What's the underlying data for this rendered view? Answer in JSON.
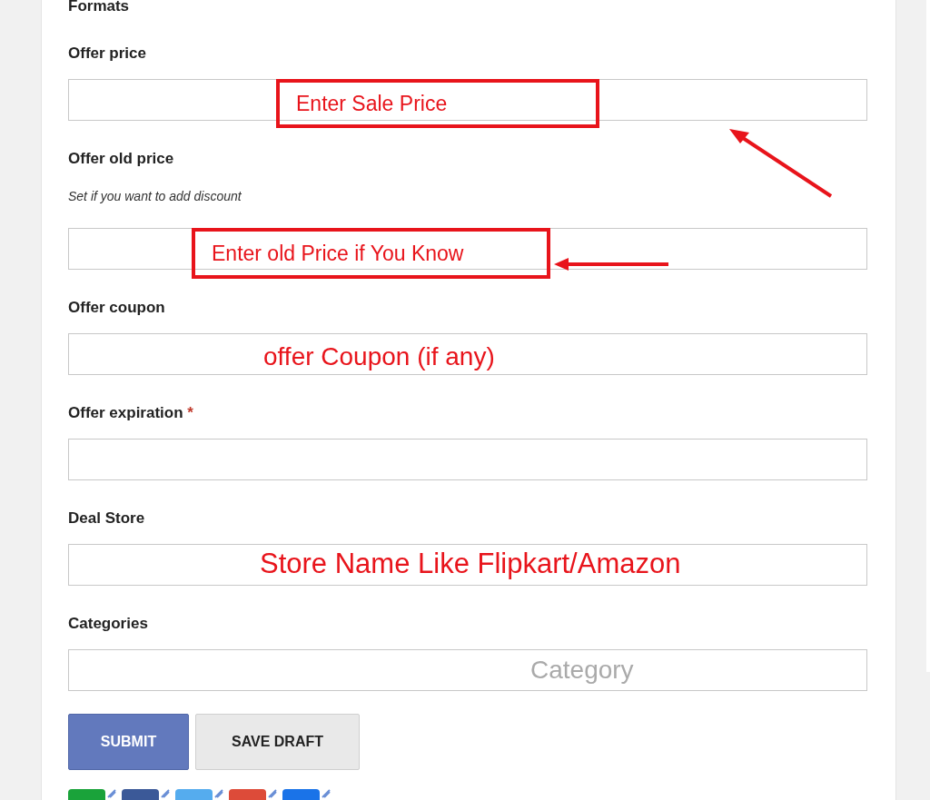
{
  "section_title": "Formats",
  "fields": [
    {
      "label": "Offer price",
      "required": false,
      "annotation": {
        "kind": "boxed",
        "text": "Enter Sale Price",
        "arrow": true
      }
    },
    {
      "label": "Offer old price",
      "hint": "Set if you want to add discount",
      "required": false,
      "annotation": {
        "kind": "boxed",
        "text": "Enter old Price if You Know",
        "arrow": true
      }
    },
    {
      "label": "Offer coupon",
      "required": false,
      "annotation": {
        "kind": "plain",
        "text": "offer Coupon (if any)"
      }
    },
    {
      "label": "Offer expiration",
      "required": true,
      "required_mark": "*"
    },
    {
      "label": "Deal Store",
      "required": false,
      "annotation": {
        "kind": "plain",
        "text": "Store Name Like Flipkart/Amazon"
      }
    },
    {
      "label": "Categories",
      "required": false,
      "placeholder": "Category"
    }
  ],
  "buttons": [
    {
      "label": "SUBMIT",
      "kind": "primary"
    },
    {
      "label": "SAVE DRAFT",
      "kind": "secondary"
    }
  ],
  "share_buttons": [
    {
      "color": "#1aa33a"
    },
    {
      "color": "#3b5998"
    },
    {
      "color": "#55acee"
    },
    {
      "color": "#dd4b39"
    },
    {
      "color": "#1a73e8"
    }
  ]
}
